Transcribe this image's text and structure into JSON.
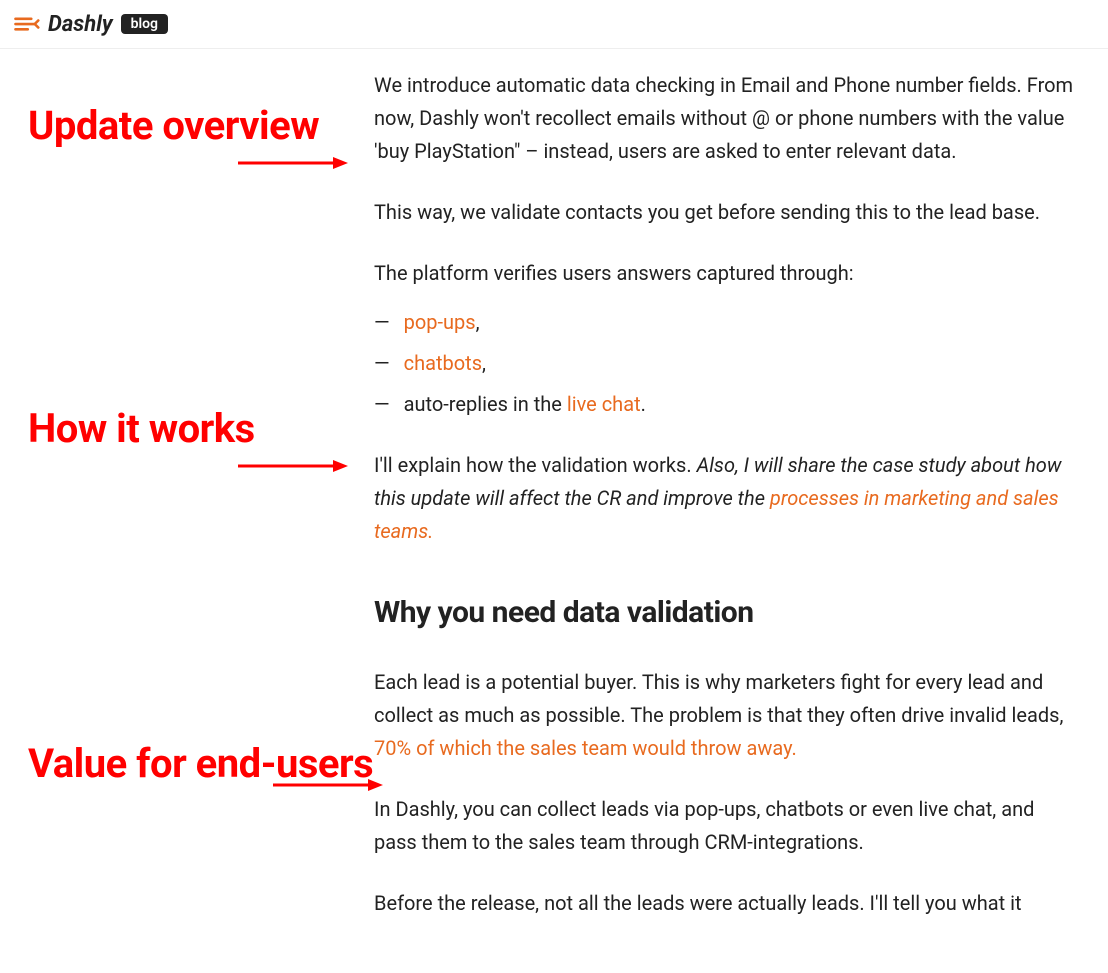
{
  "header": {
    "brand": "Dashly",
    "badge": "blog"
  },
  "annotations": {
    "a1": "Update overview",
    "a2": "How it works",
    "a3": "Value for end-users"
  },
  "article": {
    "p1": "We introduce automatic data checking in Email and Phone number fields. From now, Dashly won't recollect emails without @ or phone numbers with the value 'buy PlayStation\" – instead, users are asked to enter relevant data.",
    "p2": "This way, we validate contacts you get before sending this to the lead base.",
    "p3": "The platform verifies users answers captured through:",
    "list": {
      "dash": "—",
      "item1_link": "pop-ups",
      "item1_tail": ",",
      "item2_link": "chatbots",
      "item2_tail": ",",
      "item3_pre": "auto-replies in the ",
      "item3_link": "live chat",
      "item3_tail": "."
    },
    "p4_pre": "I'll explain how the validation works. ",
    "p4_italic_pre": "Also, I will share the case study about how this update will affect the CR and improve the ",
    "p4_link": "processes in marketing and sales teams.",
    "h2": "Why you need data validation",
    "p5_pre": "Each lead is a potential buyer. This is why marketers fight for every lead and collect as much as possible. The problem is that they often drive invalid leads, ",
    "p5_link": "70% of which the sales team would throw away.",
    "p6": "In Dashly, you can collect leads via pop-ups, chatbots or even live chat, and pass them to the sales team through CRM-integrations.",
    "p7": "Before the release, not all the leads were actually leads. I'll tell you what it"
  }
}
